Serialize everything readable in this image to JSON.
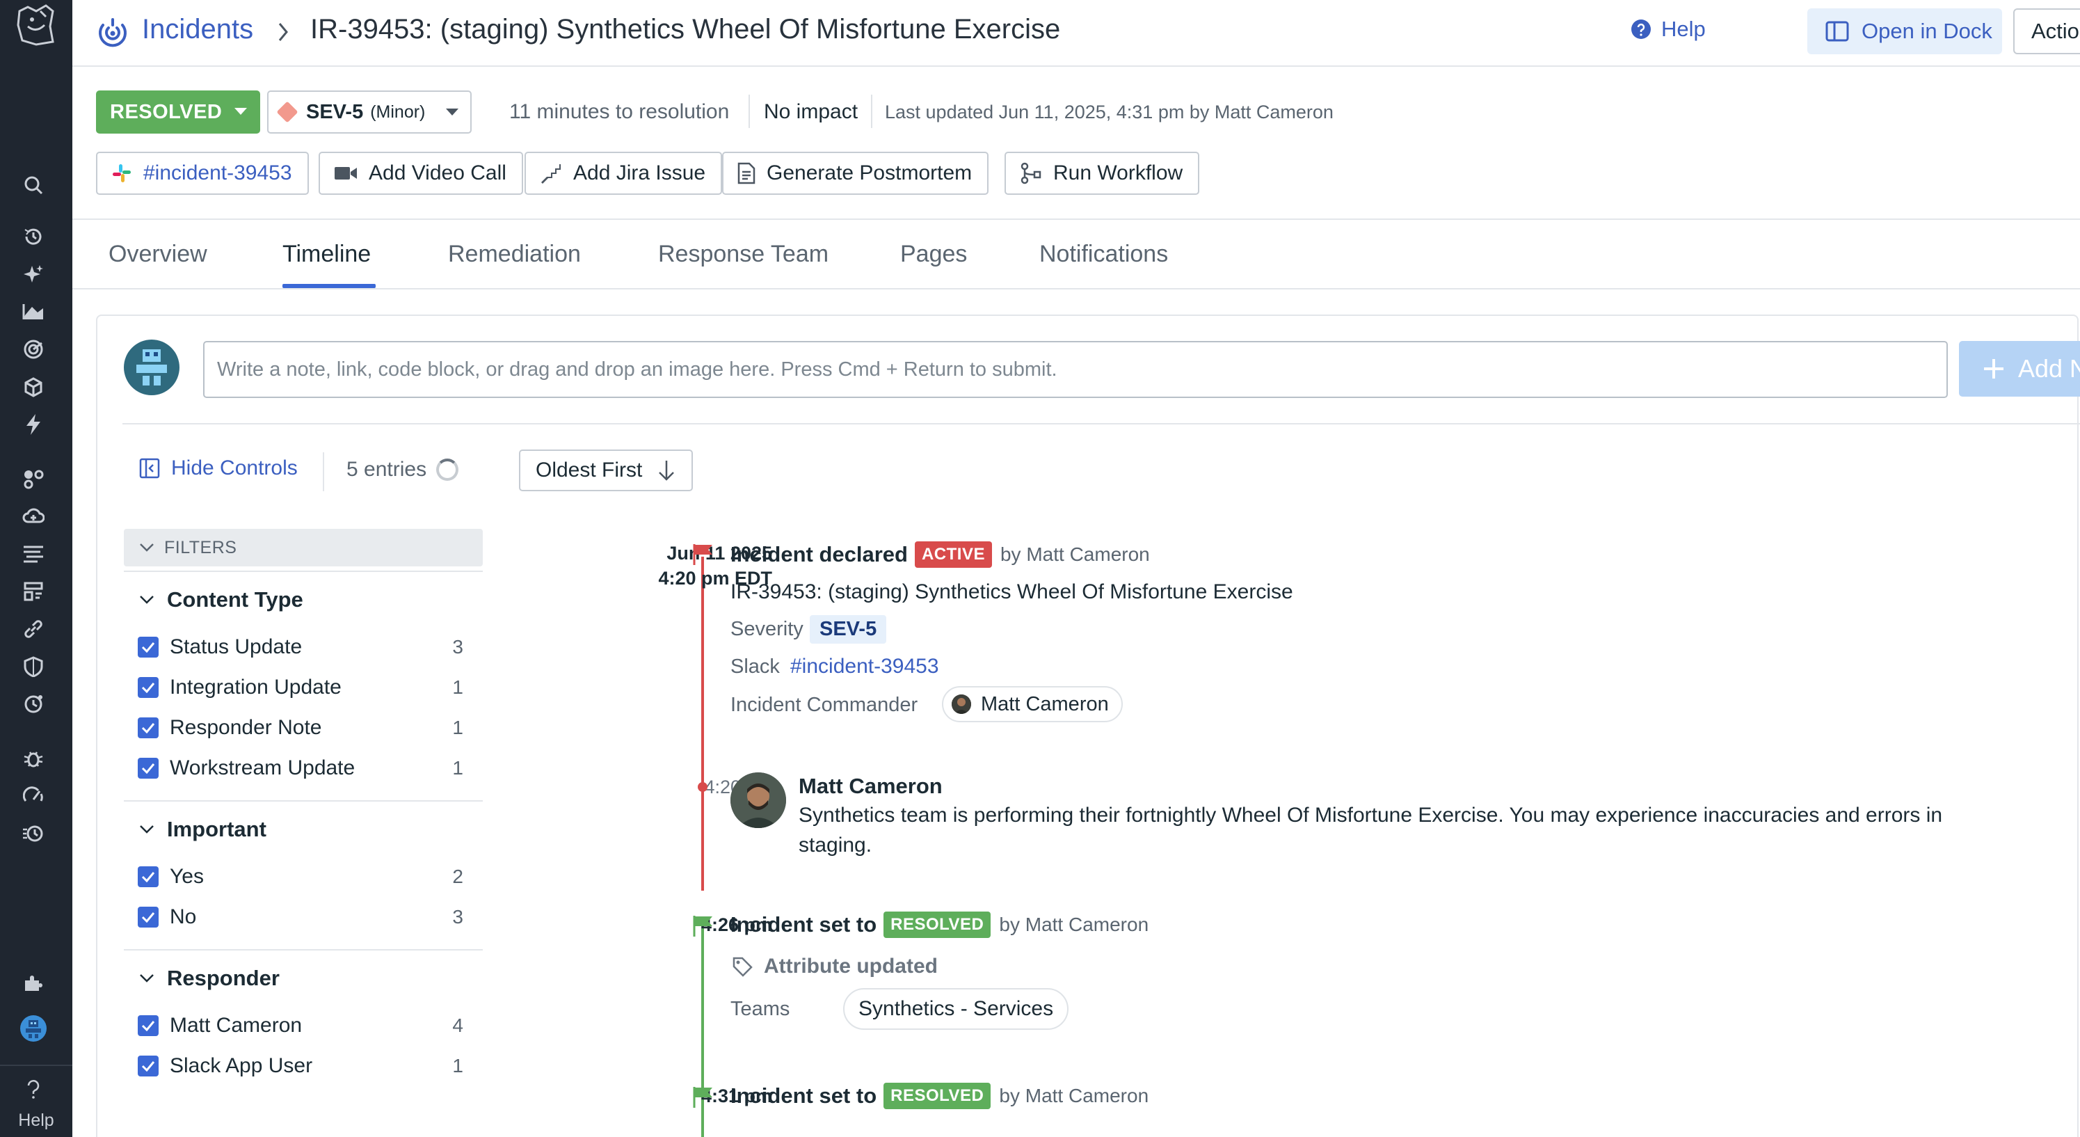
{
  "sidebar": {
    "icons": [
      "search-icon",
      "history-icon",
      "sparkle-icon",
      "chart-icon",
      "target-icon",
      "package-icon",
      "bolt-icon",
      "cluster-icon",
      "cloud-icon",
      "logs-icon",
      "apm-icon",
      "link-icon",
      "security-icon",
      "rum-icon",
      "bug-icon",
      "speed-icon",
      "synthetics-icon",
      "integrations-icon",
      "account-icon"
    ],
    "help_label": "Help"
  },
  "header": {
    "breadcrumb_root": "Incidents",
    "title": "IR-39453:  (staging) Synthetics Wheel Of Misfortune Exercise",
    "help_label": "Help",
    "open_in_dock_label": "Open in Dock",
    "actions_label": "Actions"
  },
  "status": {
    "state_label": "RESOLVED",
    "severity": "SEV-5",
    "severity_desc": "(Minor)",
    "time_to_resolution": "11 minutes to resolution",
    "impact": "No impact",
    "last_updated": "Last updated Jun 11, 2025, 4:31 pm by Matt Cameron"
  },
  "actions": {
    "slack_channel": "#incident-39453",
    "video_call": "Add Video Call",
    "jira": "Add Jira Issue",
    "postmortem": "Generate Postmortem",
    "workflow": "Run Workflow"
  },
  "tabs": [
    {
      "label": "Overview"
    },
    {
      "label": "Timeline"
    },
    {
      "label": "Remediation"
    },
    {
      "label": "Response Team"
    },
    {
      "label": "Pages"
    },
    {
      "label": "Notifications"
    }
  ],
  "active_tab": "Timeline",
  "composer": {
    "placeholder": "Write a note, link, code block, or drag and drop an image here. Press Cmd + Return to submit.",
    "add_note_label": "Add Note"
  },
  "controls": {
    "hide_controls_label": "Hide Controls",
    "entries_label": "5 entries",
    "sort_label": "Oldest First"
  },
  "filters": {
    "header": "FILTERS",
    "groups": [
      {
        "title": "Content Type",
        "items": [
          {
            "label": "Status Update",
            "count": "3"
          },
          {
            "label": "Integration Update",
            "count": "1"
          },
          {
            "label": "Responder Note",
            "count": "1"
          },
          {
            "label": "Workstream Update",
            "count": "1"
          }
        ]
      },
      {
        "title": "Important",
        "items": [
          {
            "label": "Yes",
            "count": "2"
          },
          {
            "label": "No",
            "count": "3"
          }
        ]
      },
      {
        "title": "Responder",
        "items": [
          {
            "label": "Matt Cameron",
            "count": "4"
          },
          {
            "label": "Slack App User",
            "count": "1"
          }
        ]
      }
    ]
  },
  "timeline": {
    "e1": {
      "date": "Jun 11 2025",
      "time": "4:20 pm EDT",
      "title": "Incident declared",
      "badge": "ACTIVE",
      "by": "by Matt Cameron",
      "incident_name": "IR-39453: (staging) Synthetics Wheel Of Misfortune Exercise",
      "severity_label": "Severity",
      "severity_value": "SEV-5",
      "slack_label": "Slack",
      "slack_value": "#incident-39453",
      "commander_label": "Incident Commander",
      "commander_value": "Matt Cameron"
    },
    "e2": {
      "time": "4:20 pm",
      "author": "Matt Cameron",
      "body": "Synthetics team is performing their fortnightly Wheel Of Misfortune Exercise. You may experience inaccuracies and errors in staging."
    },
    "e3": {
      "time": "4:26 pm",
      "title": "Incident set to",
      "badge": "RESOLVED",
      "by": "by Matt Cameron",
      "attribute_label": "Attribute updated",
      "teams_label": "Teams",
      "teams_value": "Synthetics - Services"
    },
    "e4": {
      "time": "4:31 pm",
      "title": "Incident set to",
      "badge": "RESOLVED",
      "by": "by Matt Cameron"
    }
  },
  "colors": {
    "accent": "#3b68d6",
    "link": "#3b5fc0",
    "resolved": "#5eae5b",
    "active": "#d84b4b",
    "sidebar_bg": "#1f2630"
  }
}
